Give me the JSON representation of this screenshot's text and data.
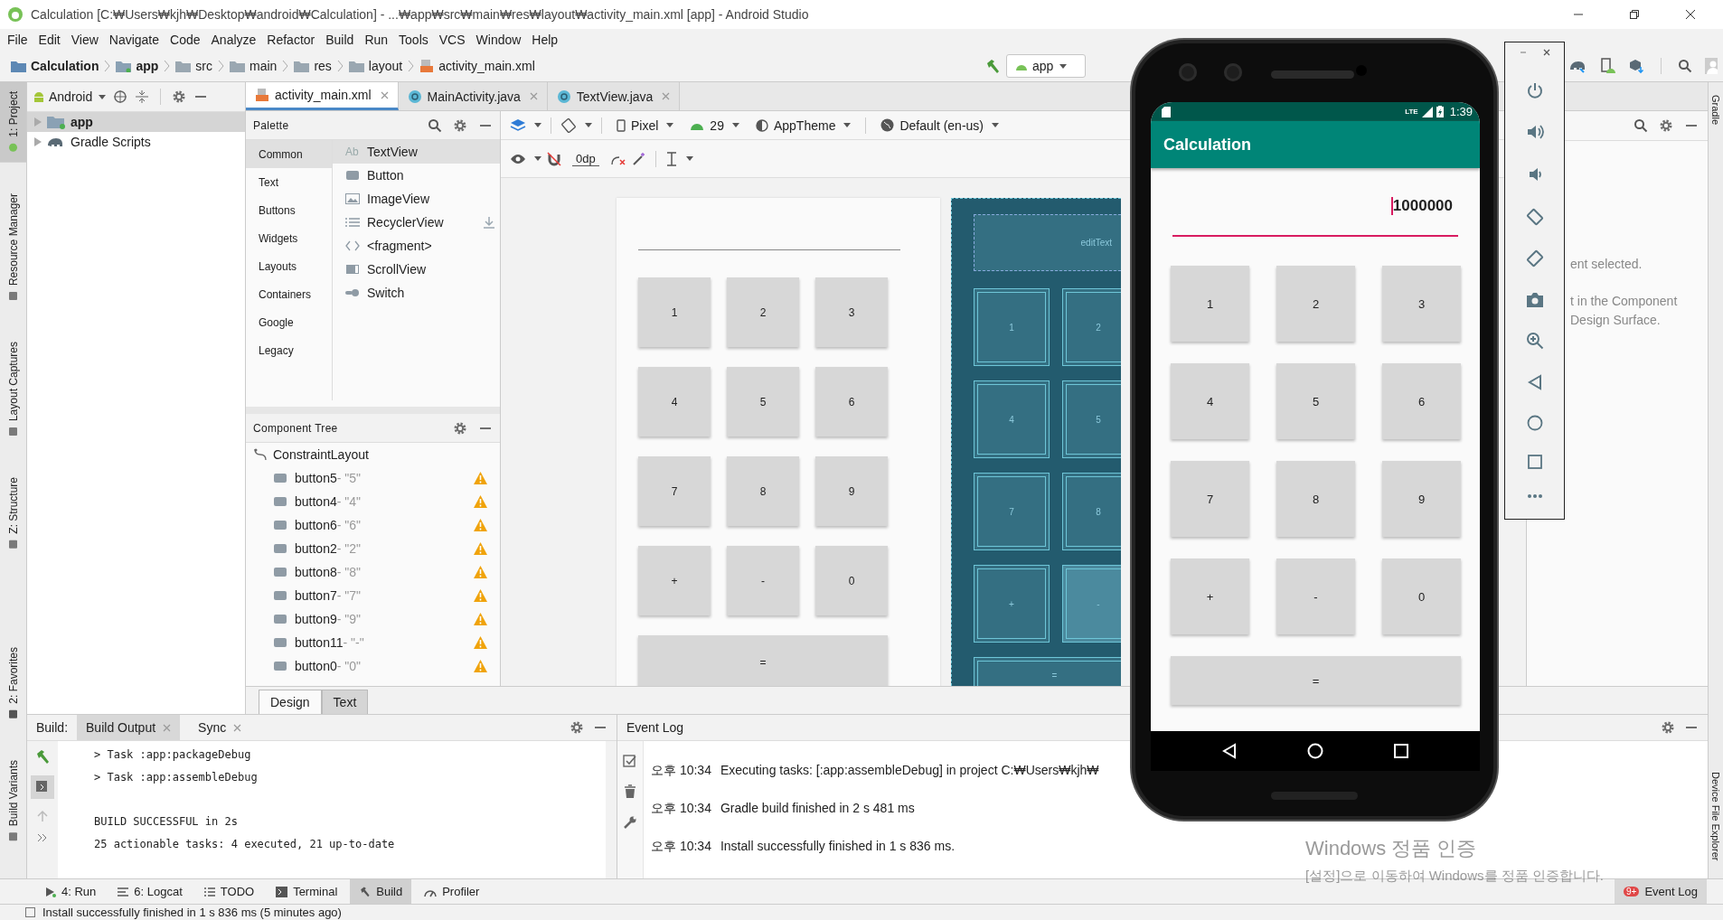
{
  "window": {
    "title": "Calculation [C:₩Users₩kjh₩Desktop₩android₩Calculation] - ...₩app₩src₩main₩res₩layout₩activity_main.xml [app] - Android Studio"
  },
  "menu": [
    "File",
    "Edit",
    "View",
    "Navigate",
    "Code",
    "Analyze",
    "Refactor",
    "Build",
    "Run",
    "Tools",
    "VCS",
    "Window",
    "Help"
  ],
  "breadcrumb": [
    {
      "label": "Calculation",
      "kind": "project"
    },
    {
      "label": "app",
      "kind": "module"
    },
    {
      "label": "src",
      "kind": "folder"
    },
    {
      "label": "main",
      "kind": "folder"
    },
    {
      "label": "res",
      "kind": "res"
    },
    {
      "label": "layout",
      "kind": "folder"
    },
    {
      "label": "activity_main.xml",
      "kind": "layout-file"
    }
  ],
  "run_config": "app",
  "left_tool_windows": [
    {
      "label": "1: Project",
      "kind": "project",
      "selected": true
    },
    {
      "label": "Resource Manager",
      "kind": "resources",
      "selected": false
    },
    {
      "label": "Layout Captures",
      "kind": "captures",
      "selected": false
    },
    {
      "label": "Z: Structure",
      "kind": "structure",
      "selected": false
    },
    {
      "label": "2: Favorites",
      "kind": "favorites",
      "selected": false
    },
    {
      "label": "Build Variants",
      "kind": "variants",
      "selected": false
    }
  ],
  "right_tool_windows": [
    "Gradle",
    "Device File Explorer"
  ],
  "project_panel": {
    "view": "Android",
    "tree": [
      {
        "label": "app",
        "kind": "module",
        "selected": true
      },
      {
        "label": "Gradle Scripts",
        "kind": "gradle",
        "selected": false
      }
    ]
  },
  "editor_tabs": [
    {
      "label": "activity_main.xml",
      "kind": "xml",
      "selected": true
    },
    {
      "label": "MainActivity.java",
      "kind": "class",
      "selected": false
    },
    {
      "label": "TextView.java",
      "kind": "class",
      "selected": false
    }
  ],
  "palette": {
    "title": "Palette",
    "categories": [
      {
        "label": "Common",
        "selected": true
      },
      {
        "label": "Text",
        "selected": false
      },
      {
        "label": "Buttons",
        "selected": false
      },
      {
        "label": "Widgets",
        "selected": false
      },
      {
        "label": "Layouts",
        "selected": false
      },
      {
        "label": "Containers",
        "selected": false
      },
      {
        "label": "Google",
        "selected": false
      },
      {
        "label": "Legacy",
        "selected": false
      }
    ],
    "items": [
      {
        "label": "TextView",
        "kind": "text",
        "glyph": "Ab",
        "selected": true,
        "download": false
      },
      {
        "label": "Button",
        "kind": "button",
        "selected": false,
        "download": false
      },
      {
        "label": "ImageView",
        "kind": "image",
        "selected": false,
        "download": false
      },
      {
        "label": "RecyclerView",
        "kind": "list",
        "selected": false,
        "download": true
      },
      {
        "label": "<fragment>",
        "kind": "code",
        "selected": false,
        "download": false
      },
      {
        "label": "ScrollView",
        "kind": "scroll",
        "selected": false,
        "download": false
      },
      {
        "label": "Switch",
        "kind": "switch",
        "selected": false,
        "download": false
      }
    ]
  },
  "design_toolbar": {
    "device": "Pixel",
    "api": "29",
    "theme": "AppTheme",
    "locale": "Default (en-us)",
    "margin": "0dp"
  },
  "component_tree": {
    "title": "Component Tree",
    "tree": [
      {
        "label": "ConstraintLayout",
        "children": [
          {
            "label": "button5",
            "detail": "- \"5\"",
            "warning": true
          },
          {
            "label": "button4",
            "detail": "- \"4\"",
            "warning": true
          },
          {
            "label": "button6",
            "detail": "- \"6\"",
            "warning": true
          },
          {
            "label": "button2",
            "detail": "- \"2\"",
            "warning": true
          },
          {
            "label": "button8",
            "detail": "- \"8\"",
            "warning": true
          },
          {
            "label": "button7",
            "detail": "- \"7\"",
            "warning": true
          },
          {
            "label": "button9",
            "detail": "- \"9\"",
            "warning": true
          },
          {
            "label": "button11",
            "detail": "- \"-\"",
            "warning": true
          },
          {
            "label": "button0",
            "detail": "- \"0\"",
            "warning": true
          }
        ]
      }
    ]
  },
  "design_preview": {
    "buttons": [
      {
        "label": "1",
        "kind": "key"
      },
      {
        "label": "2",
        "kind": "key"
      },
      {
        "label": "3",
        "kind": "key"
      },
      {
        "label": "4",
        "kind": "key"
      },
      {
        "label": "5",
        "kind": "key"
      },
      {
        "label": "6",
        "kind": "key"
      },
      {
        "label": "7",
        "kind": "key"
      },
      {
        "label": "8",
        "kind": "key"
      },
      {
        "label": "9",
        "kind": "key"
      },
      {
        "label": "+",
        "kind": "key"
      },
      {
        "label": "-",
        "kind": "key"
      },
      {
        "label": "0",
        "kind": "key"
      },
      {
        "label": "=",
        "kind": "wide"
      }
    ]
  },
  "blueprint": {
    "field": "editText",
    "buttons": [
      {
        "label": "1",
        "kind": "key",
        "highlighted": false
      },
      {
        "label": "2",
        "kind": "key",
        "highlighted": false
      },
      {
        "label": "4",
        "kind": "key",
        "highlighted": false
      },
      {
        "label": "5",
        "kind": "key",
        "highlighted": false
      },
      {
        "label": "7",
        "kind": "key",
        "highlighted": false
      },
      {
        "label": "8",
        "kind": "key",
        "highlighted": false
      },
      {
        "label": "+",
        "kind": "key",
        "highlighted": false
      },
      {
        "label": "-",
        "kind": "key",
        "highlighted": true
      },
      {
        "label": "=",
        "kind": "wide",
        "highlighted": false
      }
    ]
  },
  "view_tabs": [
    {
      "label": "Design",
      "selected": true
    },
    {
      "label": "Text",
      "selected": false
    }
  ],
  "attributes": {
    "lines": [
      "ent selected.",
      "t in the Component",
      "Design Surface."
    ]
  },
  "build": {
    "label": "Build:",
    "tabs": [
      {
        "label": "Build Output",
        "selected": true
      },
      {
        "label": "Sync",
        "selected": false
      }
    ],
    "blocks": [
      [
        "> Task :app:packageDebug",
        "> Task :app:assembleDebug"
      ],
      [
        "BUILD SUCCESSFUL in 2s",
        "25 actionable tasks: 4 executed, 21 up-to-date"
      ]
    ]
  },
  "event_log": {
    "title": "Event Log",
    "entries": [
      {
        "time": "오후 10:34",
        "message": "Executing tasks: [:app:assembleDebug] in project C:₩Users₩kjh₩"
      },
      {
        "time": "오후 10:34",
        "message": "Gradle build finished in 2 s 481 ms"
      },
      {
        "time": "오후 10:34",
        "message": "Install successfully finished in 1 s 836 ms."
      }
    ]
  },
  "bottom_tabs": [
    {
      "label": "4: Run",
      "kind": "run",
      "selected": false
    },
    {
      "label": "6: Logcat",
      "kind": "logcat",
      "selected": false
    },
    {
      "label": "TODO",
      "kind": "todo",
      "selected": false
    },
    {
      "label": "Terminal",
      "kind": "terminal",
      "selected": false
    },
    {
      "label": "Build",
      "kind": "build",
      "selected": true
    },
    {
      "label": "Profiler",
      "kind": "profiler",
      "selected": false
    }
  ],
  "event_log_button": {
    "label": "Event Log",
    "badge": "9+"
  },
  "status_bar": {
    "message": "Install successfully finished in 1 s 836 ms (5 minutes ago)"
  },
  "emulator": {
    "network": "LTE",
    "time": "1:39",
    "app_title": "Calculation",
    "display": "1000000",
    "buttons": [
      {
        "label": "1",
        "kind": "key"
      },
      {
        "label": "2",
        "kind": "key"
      },
      {
        "label": "3",
        "kind": "key"
      },
      {
        "label": "4",
        "kind": "key"
      },
      {
        "label": "5",
        "kind": "key"
      },
      {
        "label": "6",
        "kind": "key"
      },
      {
        "label": "7",
        "kind": "key"
      },
      {
        "label": "8",
        "kind": "key"
      },
      {
        "label": "9",
        "kind": "key"
      },
      {
        "label": "+",
        "kind": "key"
      },
      {
        "label": "-",
        "kind": "key"
      },
      {
        "label": "0",
        "kind": "key"
      },
      {
        "label": "=",
        "kind": "wide"
      }
    ]
  },
  "activation_notice": {
    "title": "Windows 정품 인증",
    "message": "[설정]으로 이동하여 Windows를 정품 인증합니다."
  }
}
